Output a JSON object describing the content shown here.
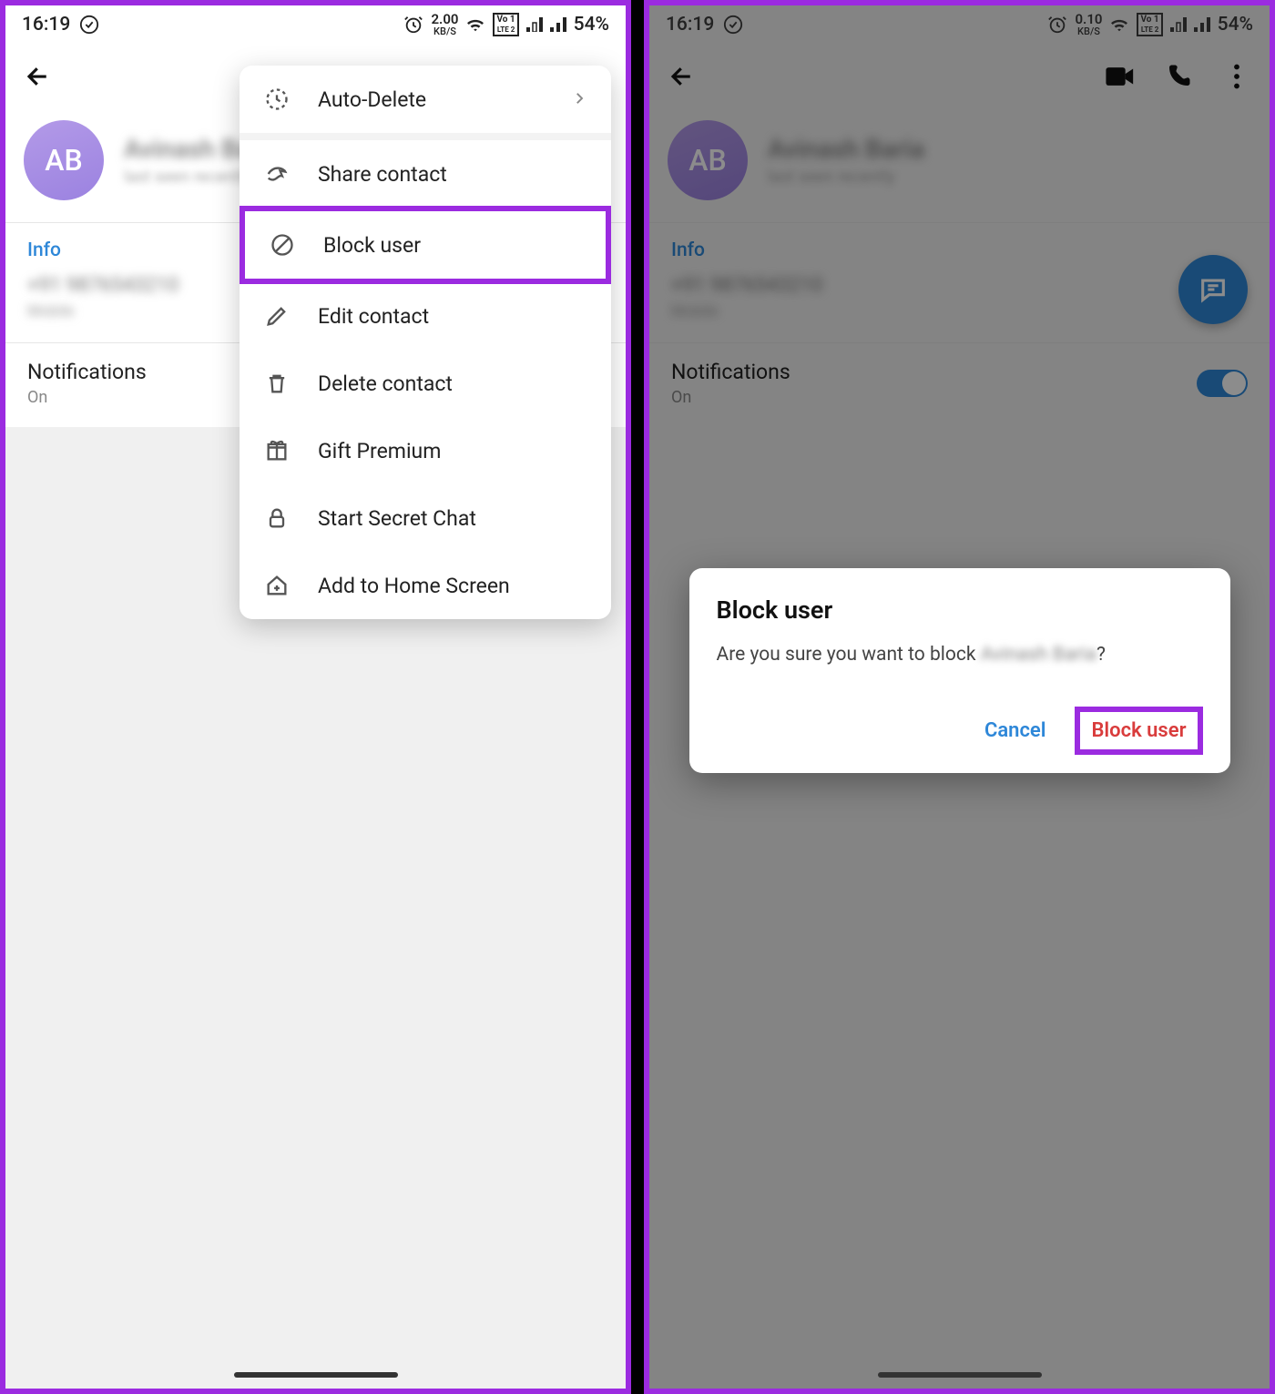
{
  "status": {
    "time": "16:19",
    "battery": "54%",
    "kbs_left": "2.00",
    "kbs_right": "0.10",
    "kbs_unit": "KB/S",
    "lte_top": "Vo 1",
    "lte_bot": "LTE 2"
  },
  "profile": {
    "initials": "AB",
    "name_blurred": "Avinash Baria",
    "status_blurred": "last seen recently"
  },
  "info": {
    "title": "Info",
    "line1": "+91 9876543210",
    "line2": "Mobile"
  },
  "notifications": {
    "title": "Notifications",
    "value": "On"
  },
  "menu": {
    "auto_delete": "Auto-Delete",
    "share_contact": "Share contact",
    "block_user": "Block user",
    "edit_contact": "Edit contact",
    "delete_contact": "Delete contact",
    "gift_premium": "Gift Premium",
    "secret_chat": "Start Secret Chat",
    "home_screen": "Add to Home Screen"
  },
  "dialog": {
    "title": "Block user",
    "message_prefix": "Are you sure you want to block ",
    "message_name": "Avinash Baria",
    "message_suffix": "?",
    "cancel": "Cancel",
    "confirm": "Block user"
  }
}
